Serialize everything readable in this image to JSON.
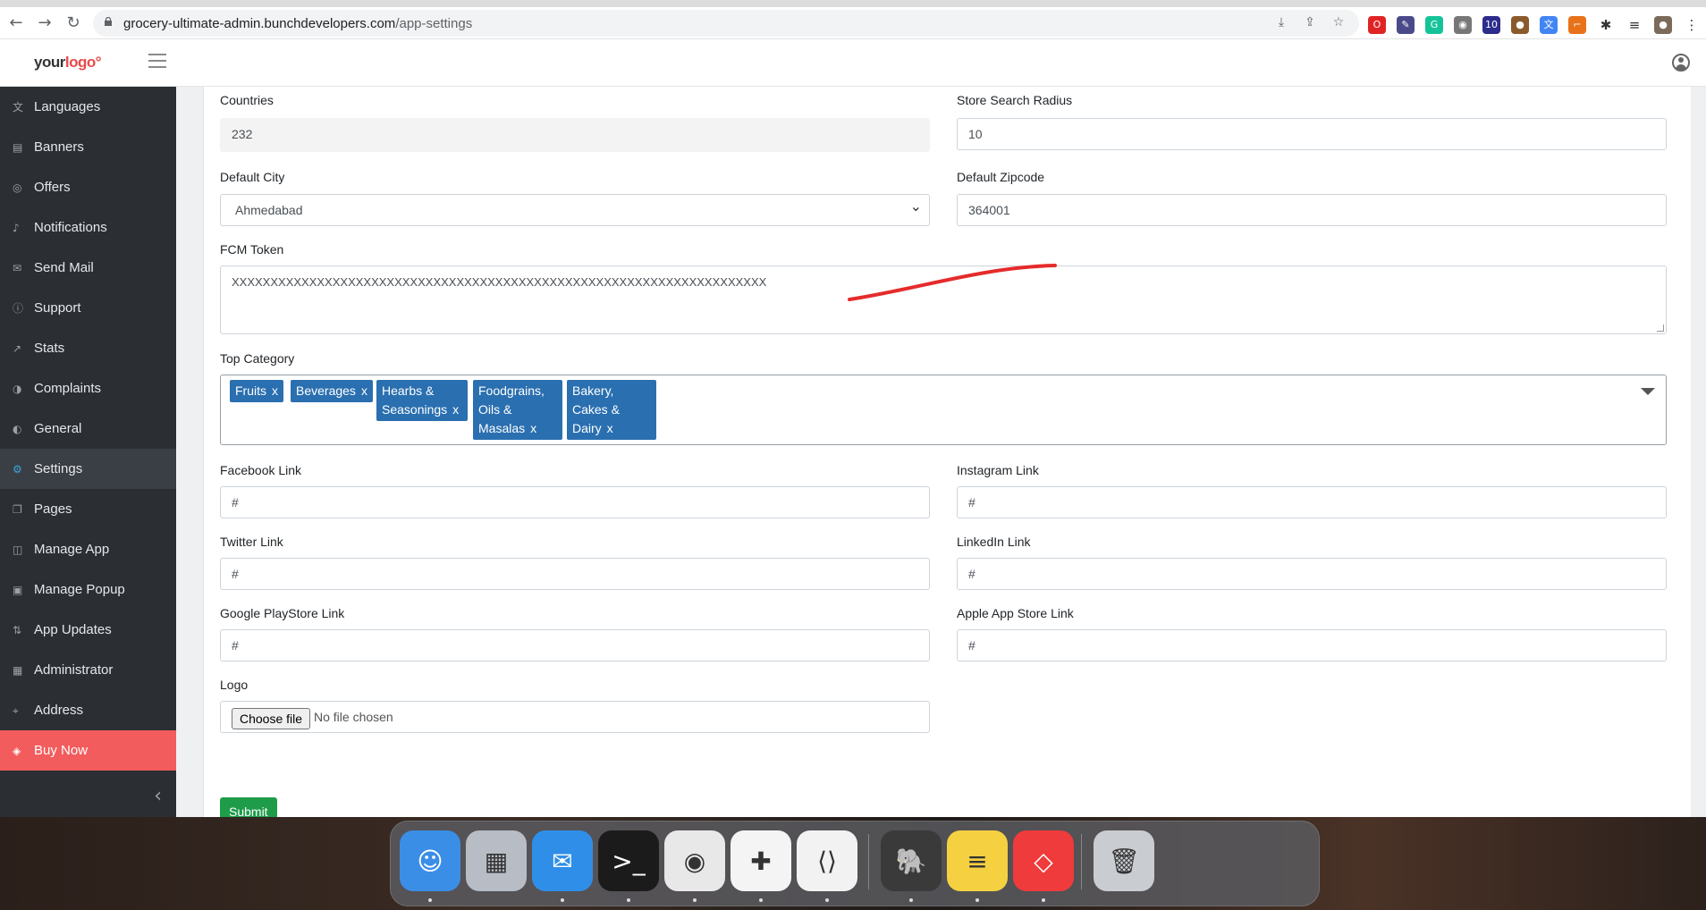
{
  "browser": {
    "url_domain": "grocery-ultimate-admin.bunchdevelopers.com",
    "url_path": "/app-settings",
    "nav": {
      "back": "←",
      "forward": "→",
      "reload": "↻"
    },
    "omnibox_icons": [
      "install-icon",
      "share-icon",
      "star-icon"
    ],
    "extensions": [
      {
        "name": "opera-icon",
        "color": "#e02424",
        "glyph": "O"
      },
      {
        "name": "eyedropper-icon",
        "color": "#4a4a8a",
        "glyph": "✎"
      },
      {
        "name": "grammarly-icon",
        "color": "#15c39a",
        "glyph": "G"
      },
      {
        "name": "camera-icon",
        "color": "#777777",
        "glyph": "◉"
      },
      {
        "name": "extension-badge-icon",
        "color": "#2c2c8c",
        "glyph": "10"
      },
      {
        "name": "cookie-icon",
        "color": "#8b5a2b",
        "glyph": "●"
      },
      {
        "name": "translate-icon",
        "color": "#4285f4",
        "glyph": "文"
      },
      {
        "name": "ruler-icon",
        "color": "#e8711a",
        "glyph": "⌐"
      },
      {
        "name": "puzzle-icon",
        "color": "#333333",
        "glyph": "✱"
      },
      {
        "name": "reading-list-icon",
        "color": "#333333",
        "glyph": "≡"
      },
      {
        "name": "profile-avatar-icon",
        "color": "#7a6a5a",
        "glyph": "●"
      },
      {
        "name": "menu-dots-icon",
        "color": "#333333",
        "glyph": "⋮"
      }
    ]
  },
  "header": {
    "logo_text": "your",
    "logo_accent": "logo",
    "logo_mark": "°"
  },
  "sidebar": {
    "items": [
      {
        "label": "Languages",
        "icon": "languages-icon",
        "glyph": "文"
      },
      {
        "label": "Banners",
        "icon": "banners-icon",
        "glyph": "▤"
      },
      {
        "label": "Offers",
        "icon": "offers-icon",
        "glyph": "◎"
      },
      {
        "label": "Notifications",
        "icon": "bell-icon",
        "glyph": "♪"
      },
      {
        "label": "Send Mail",
        "icon": "mail-icon",
        "glyph": "✉"
      },
      {
        "label": "Support",
        "icon": "support-icon",
        "glyph": "ⓘ"
      },
      {
        "label": "Stats",
        "icon": "stats-icon",
        "glyph": "↗"
      },
      {
        "label": "Complaints",
        "icon": "complaints-icon",
        "glyph": "◑"
      },
      {
        "label": "General",
        "icon": "general-icon",
        "glyph": "◐"
      },
      {
        "label": "Settings",
        "icon": "gear-icon",
        "glyph": "⚙"
      },
      {
        "label": "Pages",
        "icon": "pages-icon",
        "glyph": "❐"
      },
      {
        "label": "Manage App",
        "icon": "lock-icon",
        "glyph": "◫"
      },
      {
        "label": "Manage Popup",
        "icon": "popup-icon",
        "glyph": "▣"
      },
      {
        "label": "App Updates",
        "icon": "updates-icon",
        "glyph": "⇅"
      },
      {
        "label": "Administrator",
        "icon": "admin-icon",
        "glyph": "▦"
      },
      {
        "label": "Address",
        "icon": "location-icon",
        "glyph": "⌖"
      },
      {
        "label": "Buy Now",
        "icon": "layers-icon",
        "glyph": "◈"
      }
    ],
    "active": "Settings",
    "collapse_glyph": "‹"
  },
  "form": {
    "countries": {
      "label": "Countries",
      "value": "232"
    },
    "store_radius": {
      "label": "Store Search Radius",
      "value": "10"
    },
    "default_city": {
      "label": "Default City",
      "value": "Ahmedabad"
    },
    "default_zip": {
      "label": "Default Zipcode",
      "value": "364001"
    },
    "fcm_token": {
      "label": "FCM Token",
      "value": "XXXXXXXXXXXXXXXXXXXXXXXXXXXXXXXXXXXXXXXXXXXXXXXXXXXXXXXXXXXXXXXXXXXXX"
    },
    "top_category": {
      "label": "Top Category",
      "remove_glyph": "x",
      "tags": [
        {
          "lines": [
            "Fruits"
          ]
        },
        {
          "lines": [
            "Beverages"
          ]
        },
        {
          "lines": [
            "Hearbs &",
            "Seasonings"
          ]
        },
        {
          "lines": [
            "Foodgrains,",
            "Oils &",
            "Masalas"
          ]
        },
        {
          "lines": [
            "Bakery,",
            "Cakes &",
            "Dairy"
          ]
        }
      ]
    },
    "facebook": {
      "label": "Facebook Link",
      "value": "#"
    },
    "instagram": {
      "label": "Instagram Link",
      "value": "#"
    },
    "twitter": {
      "label": "Twitter Link",
      "value": "#"
    },
    "linkedin": {
      "label": "LinkedIn Link",
      "value": "#"
    },
    "playstore": {
      "label": "Google PlayStore Link",
      "value": "#"
    },
    "appstore": {
      "label": "Apple App Store Link",
      "value": "#"
    },
    "logo": {
      "label": "Logo",
      "button": "Choose file",
      "status": "No file chosen"
    },
    "submit_label": "Submit"
  },
  "annotation_color": "#e52b2b",
  "dock": {
    "apps": [
      {
        "name": "finder-icon",
        "glyph": "☺",
        "color": "#3a8ee6",
        "dot": true
      },
      {
        "name": "launchpad-icon",
        "glyph": "▦",
        "color": "#b8bcc4",
        "dot": false
      },
      {
        "name": "mail-app-icon",
        "glyph": "✉",
        "color": "#2f8fe8",
        "dot": true
      },
      {
        "name": "terminal-icon",
        "glyph": ">_",
        "color": "#1b1b1b",
        "dot": true
      },
      {
        "name": "chrome-icon",
        "glyph": "◉",
        "color": "#e8e8e8",
        "dot": true
      },
      {
        "name": "slack-icon",
        "glyph": "✚",
        "color": "#f4f4f4",
        "dot": true
      },
      {
        "name": "vscode-icon",
        "glyph": "⟨⟩",
        "color": "#f2f2f2",
        "dot": true
      },
      {
        "name": "tableplus-icon",
        "glyph": "🐘",
        "color": "#3a3a3a",
        "dot": true
      },
      {
        "name": "notes-icon",
        "glyph": "≡",
        "color": "#f5d142",
        "dot": true
      },
      {
        "name": "anydesk-icon",
        "glyph": "◇",
        "color": "#ef3b3b",
        "dot": true
      },
      {
        "name": "trash-icon",
        "glyph": "🗑",
        "color": "#c9ccd1",
        "dot": false
      }
    ]
  }
}
